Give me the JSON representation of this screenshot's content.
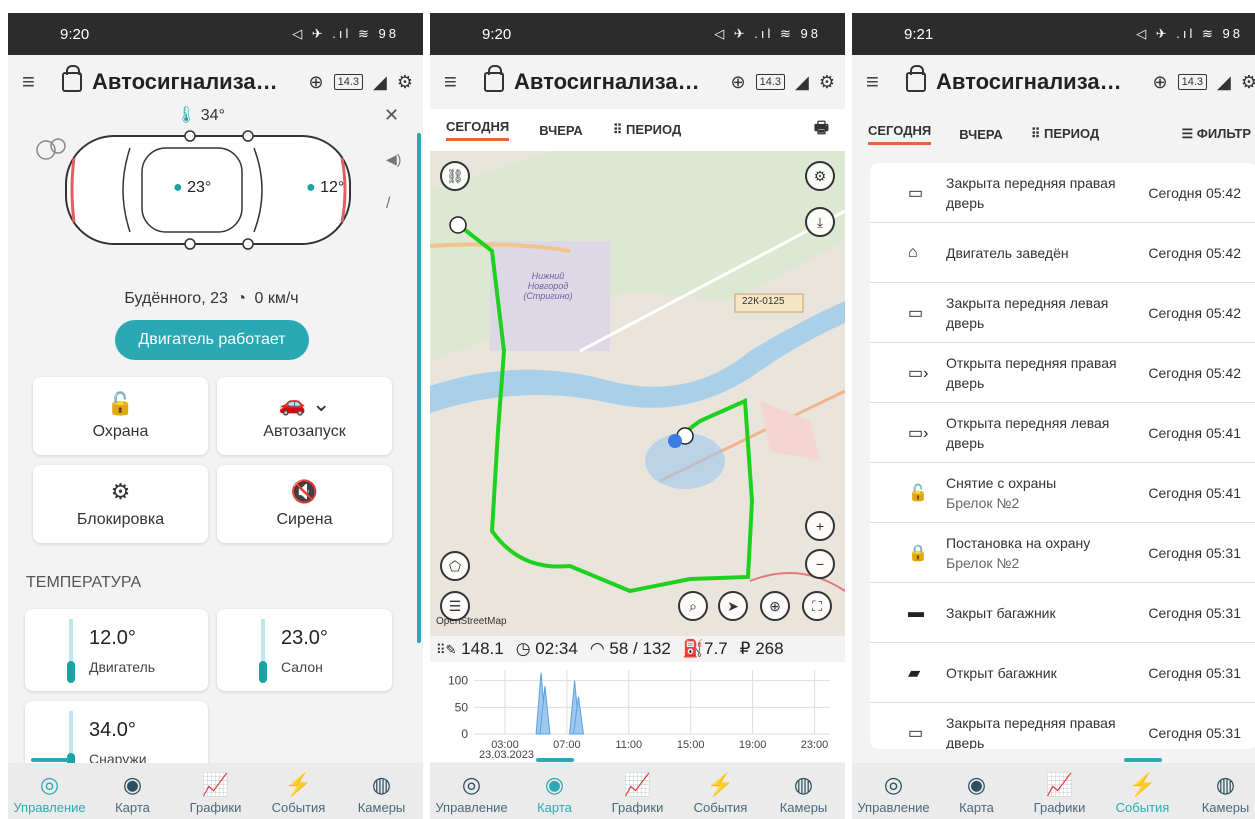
{
  "status_bar": [
    {
      "time": "9:20",
      "icons": "◁ ✈ .ıl ≋ 98"
    },
    {
      "time": "9:20",
      "icons": "◁ ✈ .ıl ≋ 98"
    },
    {
      "time": "9:21",
      "icons": "◁ ✈ .ıl ≋ 98"
    }
  ],
  "app_bar": {
    "title": "Автосигнализа…",
    "battery": "14.3"
  },
  "control": {
    "interior_temp": "34°",
    "front_temp": "23°",
    "rear_temp": "12°",
    "address": "Будённого, 23",
    "speed": "0 км/ч",
    "engine_button": "Двигатель работает",
    "cards": [
      {
        "label": "Охрана",
        "icon": "unlock-icon"
      },
      {
        "label": "Автозапуск",
        "icon": "car-start-icon"
      },
      {
        "label": "Блокировка",
        "icon": "engine-block-icon"
      },
      {
        "label": "Сирена",
        "icon": "siren-off-icon"
      }
    ],
    "temp_header": "ТЕМПЕРАТУРА",
    "temps": [
      {
        "value": "12.0°",
        "label": "Двигатель"
      },
      {
        "value": "23.0°",
        "label": "Салон"
      },
      {
        "value": "34.0°",
        "label": "Снаружи"
      }
    ]
  },
  "tabs": {
    "today": "СЕГОДНЯ",
    "yesterday": "ВЧЕРА",
    "period": "ПЕРИОД",
    "filter": "ФИЛЬТР"
  },
  "map": {
    "labels": {
      "city": "Нижний Новгород (Стригино)",
      "road": "22К-0125",
      "attribution": "OpenStreetMap"
    },
    "stats": {
      "distance": "148.1",
      "duration": "02:34",
      "speed": "58 / 132",
      "fuel": "7.7",
      "cost": "₽ 268"
    },
    "chart": {
      "y_ticks": [
        "100",
        "50",
        "0"
      ],
      "x_ticks": [
        "03:00",
        "07:00",
        "11:00",
        "15:00",
        "19:00",
        "23:00"
      ],
      "date": "23.03.2023"
    }
  },
  "chart_data": {
    "type": "area",
    "x": [
      "03:00",
      "07:00",
      "11:00",
      "15:00",
      "19:00",
      "23:00"
    ],
    "ylim": [
      0,
      120
    ],
    "series": [
      {
        "values": [
          0,
          0,
          0,
          0,
          0,
          0
        ]
      }
    ],
    "peaks": [
      {
        "x": "05:20",
        "y": 115
      },
      {
        "x": "05:35",
        "y": 90
      },
      {
        "x": "07:30",
        "y": 100
      },
      {
        "x": "07:45",
        "y": 70
      }
    ]
  },
  "events": [
    {
      "title": "Закрыта передняя правая дверь",
      "sub": "",
      "date": "Сегодня 05:42",
      "icon": "door-closed-icon"
    },
    {
      "title": "Двигатель заведён",
      "sub": "",
      "date": "Сегодня 05:42",
      "icon": "engine-icon"
    },
    {
      "title": "Закрыта передняя левая дверь",
      "sub": "",
      "date": "Сегодня 05:42",
      "icon": "door-closed-icon"
    },
    {
      "title": "Открыта передняя правая дверь",
      "sub": "",
      "date": "Сегодня 05:42",
      "icon": "door-open-icon"
    },
    {
      "title": "Открыта передняя левая дверь",
      "sub": "",
      "date": "Сегодня 05:41",
      "icon": "door-open-icon"
    },
    {
      "title": "Снятие с охраны",
      "sub": "Брелок №2",
      "date": "Сегодня 05:41",
      "icon": "unlock-icon"
    },
    {
      "title": "Постановка на охрану",
      "sub": "Брелок №2",
      "date": "Сегодня 05:31",
      "icon": "lock-icon"
    },
    {
      "title": "Закрыт багажник",
      "sub": "",
      "date": "Сегодня 05:31",
      "icon": "trunk-closed-icon"
    },
    {
      "title": "Открыт багажник",
      "sub": "",
      "date": "Сегодня 05:31",
      "icon": "trunk-open-icon"
    },
    {
      "title": "Закрыта передняя правая дверь",
      "sub": "",
      "date": "Сегодня 05:31",
      "icon": "door-closed-icon"
    }
  ],
  "nav": [
    {
      "label": "Управление",
      "icon": "control-icon"
    },
    {
      "label": "Карта",
      "icon": "map-pin-icon"
    },
    {
      "label": "Графики",
      "icon": "chart-icon"
    },
    {
      "label": "События",
      "icon": "lightning-icon"
    },
    {
      "label": "Камеры",
      "icon": "camera-icon"
    }
  ]
}
